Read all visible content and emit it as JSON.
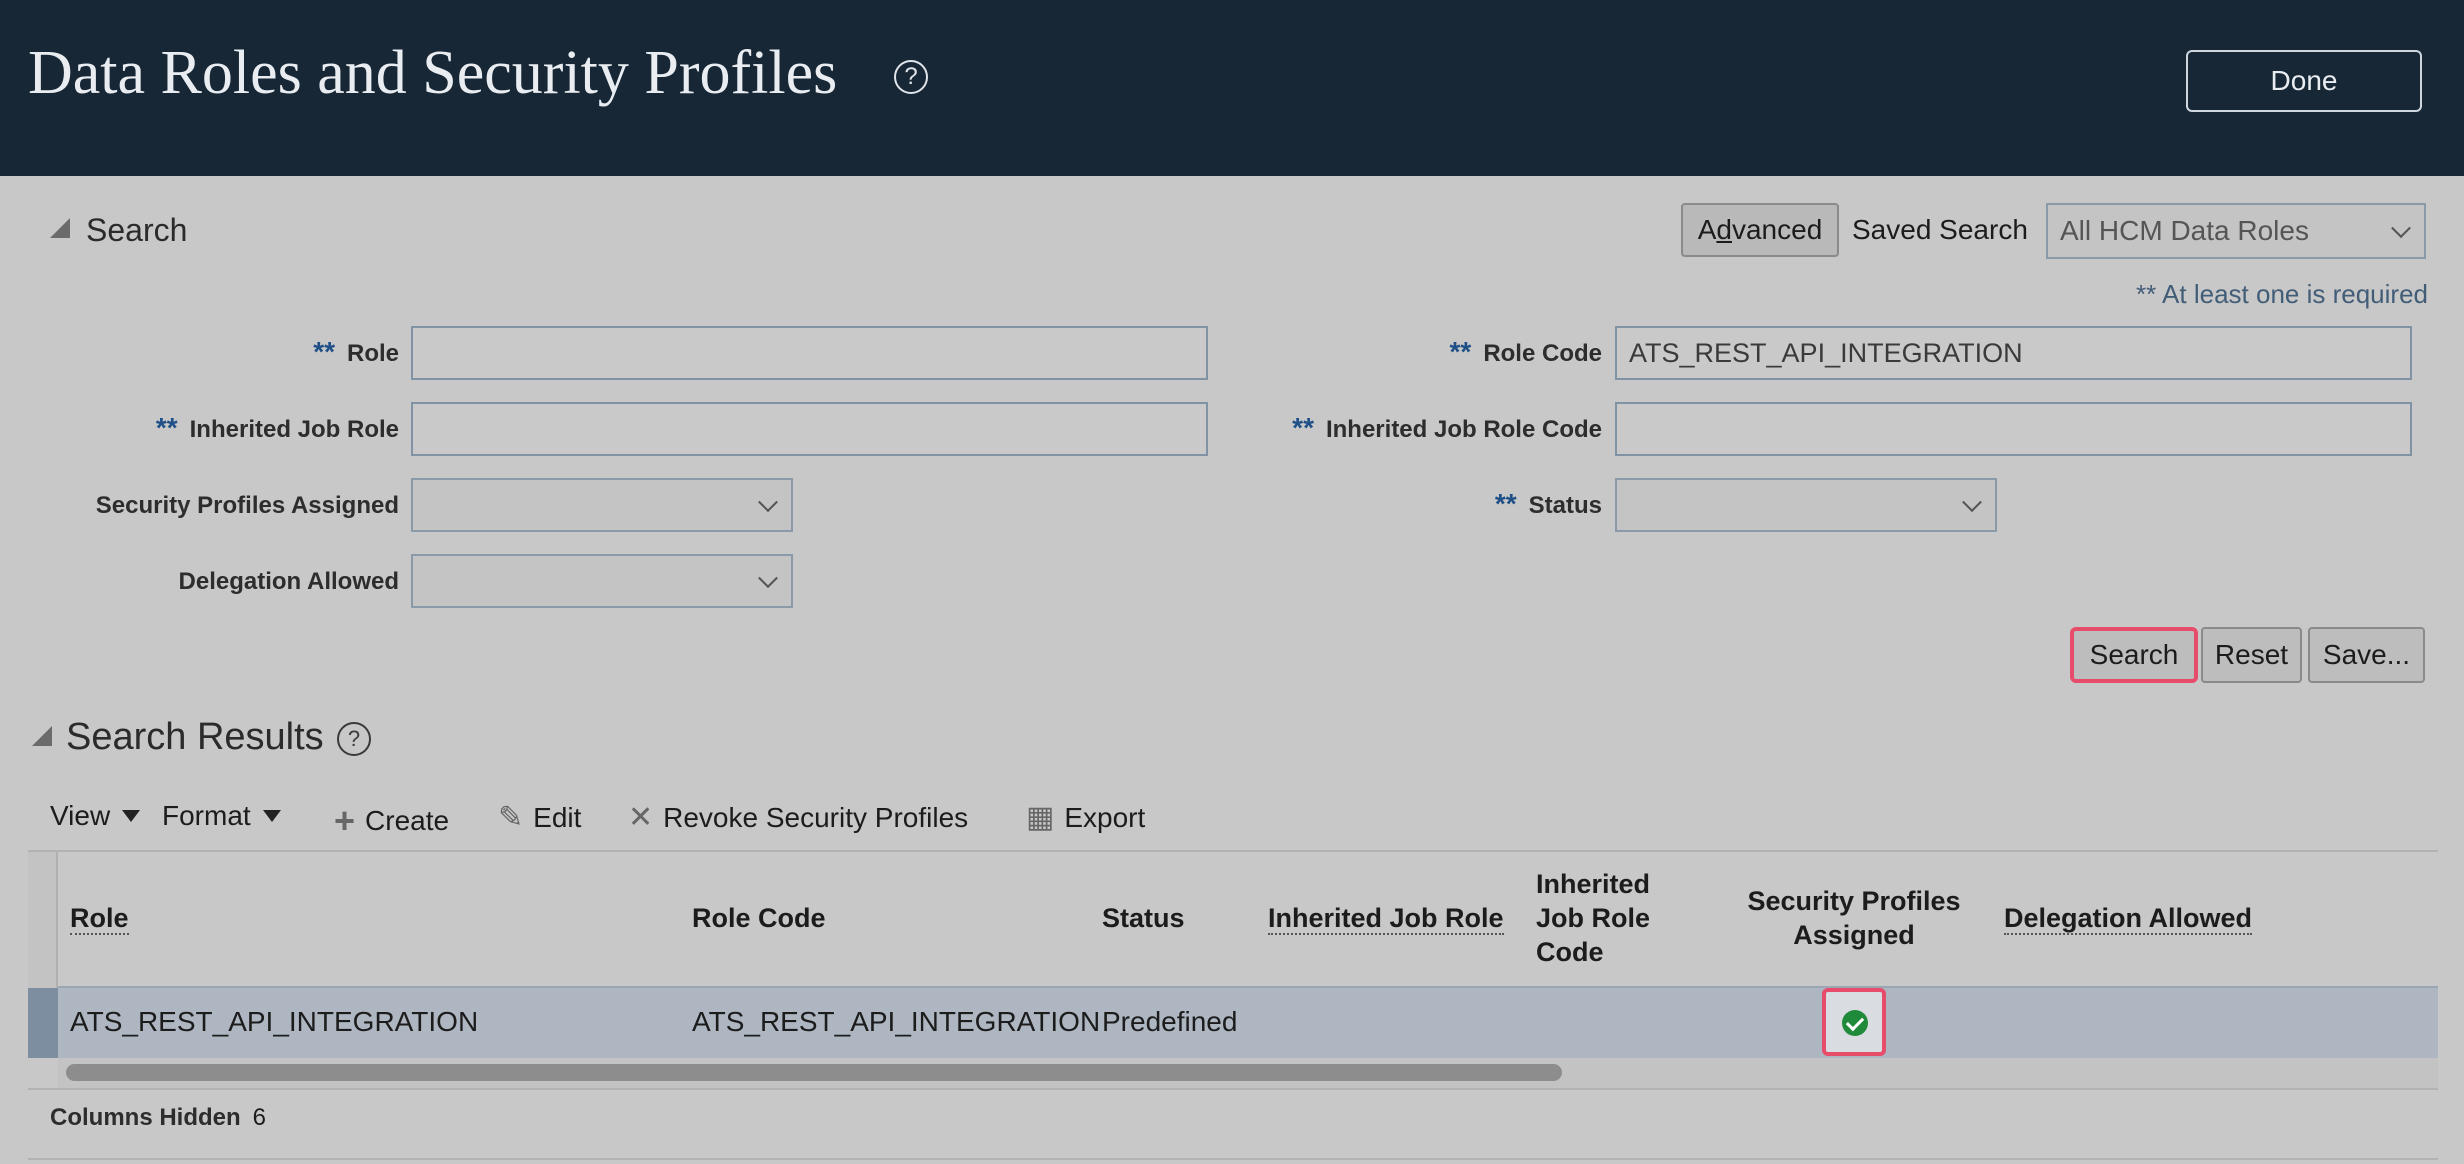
{
  "header": {
    "title": "Data Roles and Security Profiles",
    "help_symbol": "?",
    "done_label": "Done"
  },
  "search": {
    "heading": "Search",
    "advanced_label": "Advanced",
    "saved_search_label": "Saved Search",
    "saved_search_value": "All HCM Data Roles",
    "required_note": "** At least one is required",
    "required_marker": "**",
    "fields": {
      "role": {
        "label": "Role",
        "value": ""
      },
      "role_code": {
        "label": "Role Code",
        "value": "ATS_REST_API_INTEGRATION"
      },
      "inherited_job_role": {
        "label": "Inherited Job Role",
        "value": ""
      },
      "inherited_job_role_code": {
        "label": "Inherited Job Role Code",
        "value": ""
      },
      "security_profiles_assigned": {
        "label": "Security Profiles Assigned",
        "value": ""
      },
      "status": {
        "label": "Status",
        "value": ""
      },
      "delegation_allowed": {
        "label": "Delegation Allowed",
        "value": ""
      }
    },
    "buttons": {
      "search": "Search",
      "reset": "Reset",
      "save": "Save..."
    }
  },
  "results": {
    "heading": "Search Results",
    "help_symbol": "?",
    "toolbar": {
      "view": "View",
      "format": "Format",
      "create": "Create",
      "edit": "Edit",
      "revoke": "Revoke Security Profiles",
      "export": "Export"
    },
    "columns": {
      "role": "Role",
      "role_code": "Role Code",
      "status": "Status",
      "inherited_job_role": "Inherited Job Role",
      "inherited_job_role_code_1": "Inherited",
      "inherited_job_role_code_2": "Job Role",
      "inherited_job_role_code_3": "Code",
      "security_profiles_assigned_1": "Security Profiles",
      "security_profiles_assigned_2": "Assigned",
      "delegation_allowed": "Delegation Allowed"
    },
    "rows": [
      {
        "role": "ATS_REST_API_INTEGRATION",
        "role_code": "ATS_REST_API_INTEGRATION",
        "status": "Predefined",
        "inherited_job_role": "",
        "inherited_job_role_code": "",
        "security_profiles_assigned": true,
        "delegation_allowed": ""
      }
    ],
    "columns_hidden_label": "Columns Hidden",
    "columns_hidden_count": "6"
  },
  "colors": {
    "header_bg": "#172736",
    "page_bg": "#c8c8c8",
    "highlight": "#e84c6b",
    "selected_row": "#adb6c1",
    "check_green": "#1f8a3a"
  },
  "icons": {
    "create": "plus-icon",
    "edit": "pencil-icon",
    "revoke": "x-icon",
    "export": "spreadsheet-icon"
  }
}
